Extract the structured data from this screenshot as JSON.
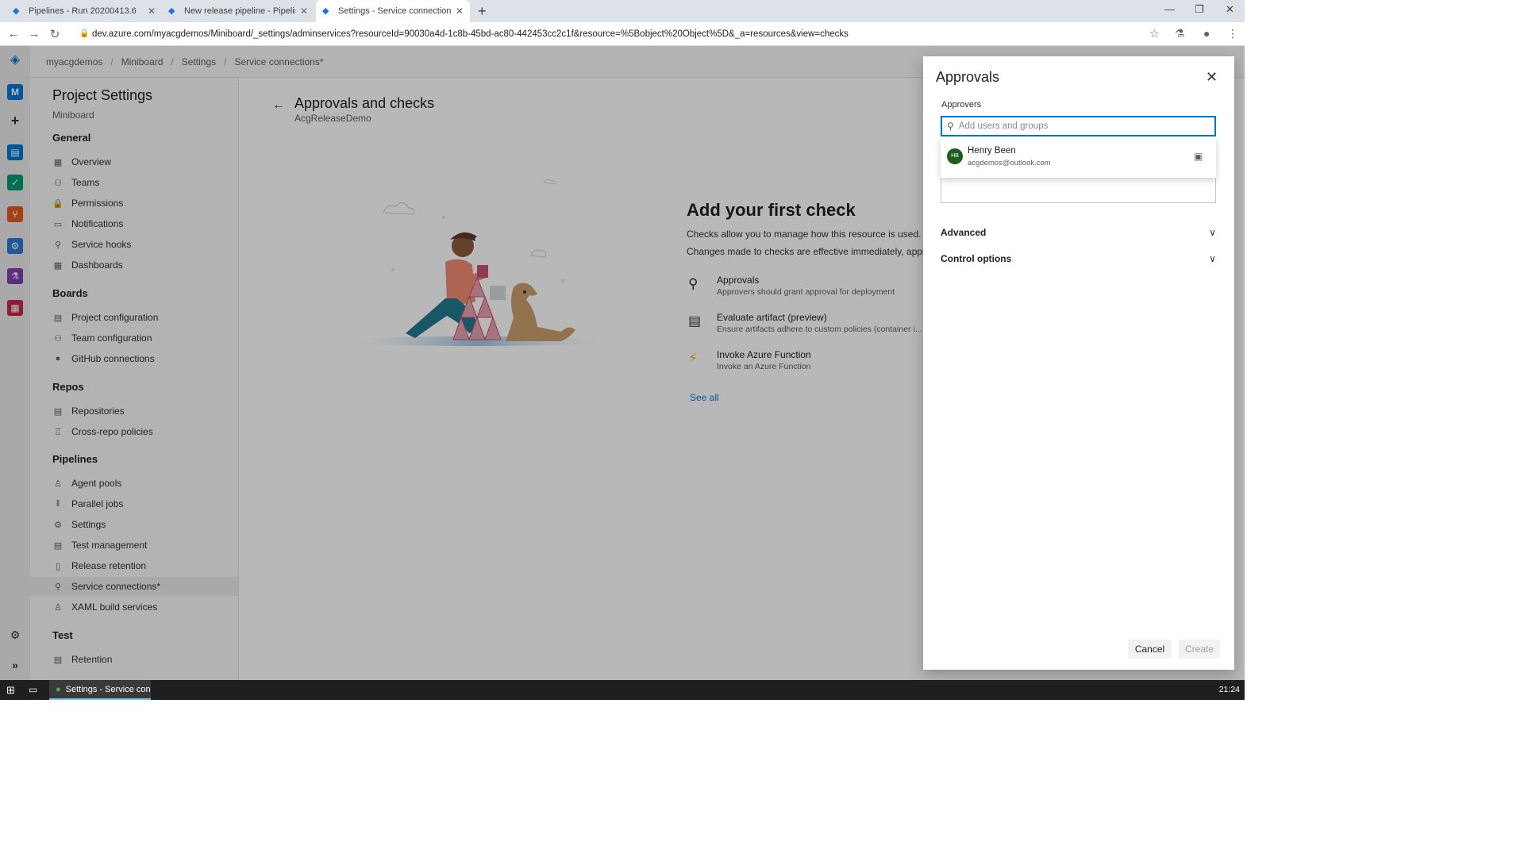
{
  "browser": {
    "tabs": [
      {
        "title": "Pipelines - Run 20200413.6"
      },
      {
        "title": "New release pipeline - Pipelines"
      },
      {
        "title": "Settings - Service connections* (N"
      }
    ],
    "url": "dev.azure.com/myacgdemos/Miniboard/_settings/adminservices?resourceId=90030a4d-1c8b-45bd-ac80-442453cc2c1f&resource=%5Bobject%20Object%5D&_a=resources&view=checks"
  },
  "breadcrumb": [
    "myacgdemos",
    "Miniboard",
    "Settings",
    "Service connections*"
  ],
  "sidebar": {
    "title": "Project Settings",
    "subtitle": "Miniboard",
    "sections": [
      {
        "heading": "General",
        "items": [
          "Overview",
          "Teams",
          "Permissions",
          "Notifications",
          "Service hooks",
          "Dashboards"
        ]
      },
      {
        "heading": "Boards",
        "items": [
          "Project configuration",
          "Team configuration",
          "GitHub connections"
        ]
      },
      {
        "heading": "Repos",
        "items": [
          "Repositories",
          "Cross-repo policies"
        ]
      },
      {
        "heading": "Pipelines",
        "items": [
          "Agent pools",
          "Parallel jobs",
          "Settings",
          "Test management",
          "Release retention",
          "Service connections*",
          "XAML build services"
        ]
      },
      {
        "heading": "Test",
        "items": [
          "Retention"
        ]
      }
    ]
  },
  "main": {
    "title": "Approvals and checks",
    "subtitle": "AcgReleaseDemo",
    "heading": "Add your first check",
    "desc1": "Checks allow you to manage how this resource is used.",
    "desc2": "Changes made to checks are effective immediately, applicat",
    "checks": [
      {
        "name": "Approvals",
        "desc": "Approvers should grant approval for deployment",
        "icon": "person-icon"
      },
      {
        "name": "Evaluate artifact (preview)",
        "desc": "Ensure artifacts adhere to custom policies (container i...",
        "icon": "artifact-icon"
      },
      {
        "name": "Invoke Azure Function",
        "desc": "Invoke an Azure Function",
        "icon": "azure-function-icon"
      }
    ],
    "see_all": "See all"
  },
  "panel": {
    "title": "Approvals",
    "approvers_label": "Approvers",
    "search_placeholder": "Add users and groups",
    "suggestion": {
      "initials": "HB",
      "name": "Henry Been",
      "email": "acgdemos@outlook.com"
    },
    "advanced": "Advanced",
    "control_options": "Control options",
    "cancel": "Cancel",
    "create": "Create"
  },
  "taskbar": {
    "app": "Settings - Service con...",
    "clock": "21:24"
  },
  "colors": {
    "accent": "#0078d4",
    "avatar": "#1b5e20"
  }
}
